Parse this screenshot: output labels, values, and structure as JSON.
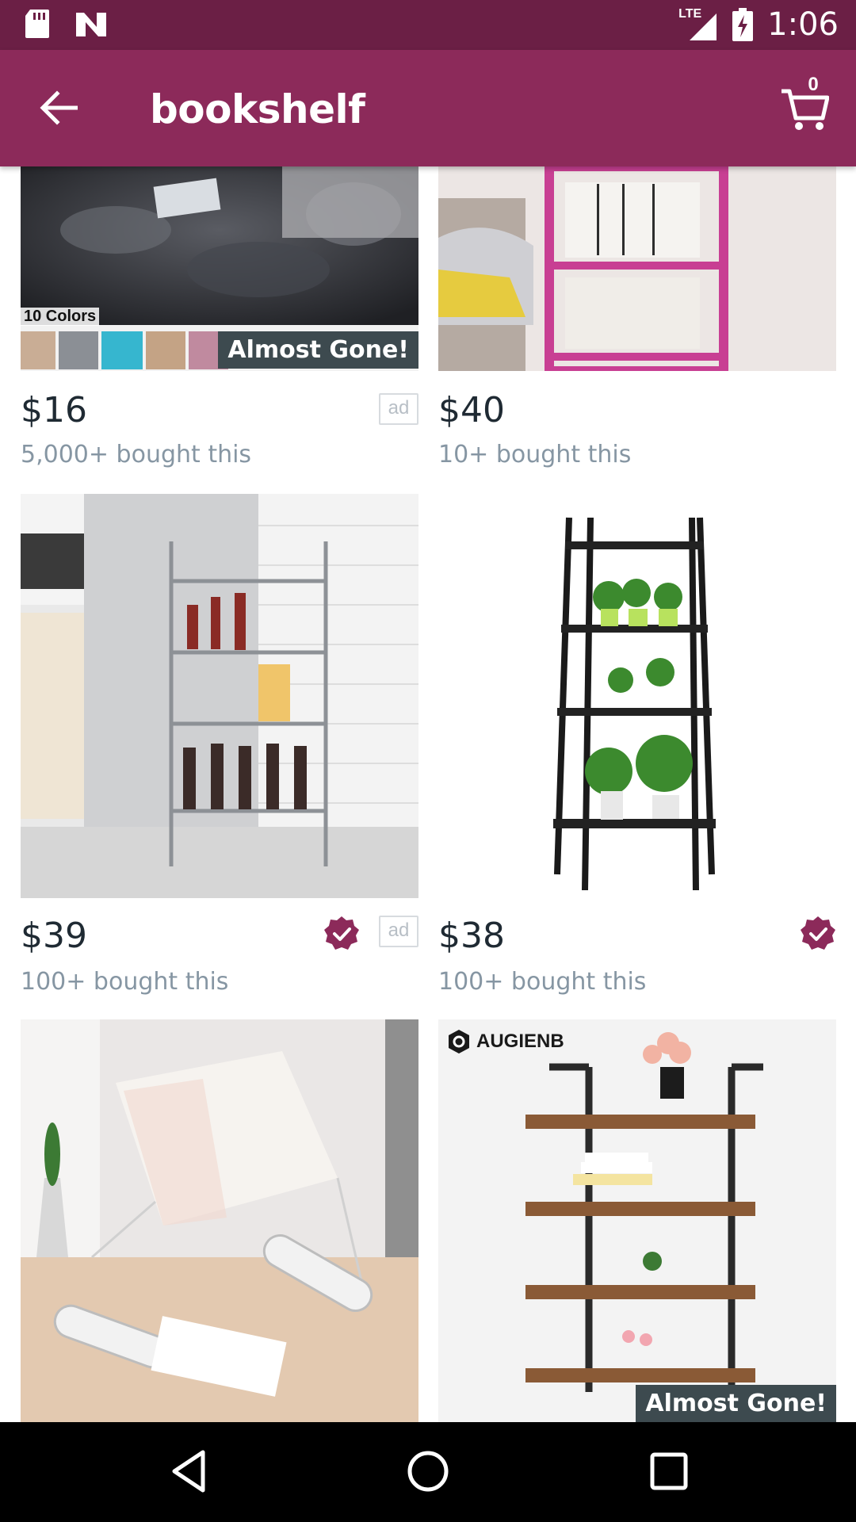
{
  "status_bar": {
    "time": "1:06",
    "network": "LTE",
    "icons": [
      "sd-card-icon",
      "n-notification-icon",
      "signal-icon",
      "battery-charging-icon"
    ]
  },
  "app_bar": {
    "title": "bookshelf",
    "cart_count": "0",
    "icons": [
      "back-arrow-icon",
      "cart-icon"
    ]
  },
  "colors": {
    "status_bar": "#6b1f45",
    "app_bar": "#8c2a5a",
    "price_text": "#1f2a33",
    "bought_text": "#8696a3",
    "badge_bg": "#3d4a4f",
    "verified": "#8c2a5a"
  },
  "products": [
    {
      "price": "$16",
      "bought": "5,000+ bought this",
      "ad": "ad",
      "badge": "Almost Gone!",
      "image_text": "10 Colors",
      "verified": false
    },
    {
      "price": "$40",
      "bought": "10+ bought this",
      "ad": "",
      "badge": "",
      "verified": false
    },
    {
      "price": "$39",
      "bought": "100+ bought this",
      "ad": "ad",
      "badge": "",
      "verified": true
    },
    {
      "price": "$38",
      "bought": "100+ bought this",
      "ad": "",
      "badge": "",
      "verified": true
    },
    {
      "price": "",
      "bought": "",
      "ad": "",
      "badge": "",
      "verified": false
    },
    {
      "price": "",
      "bought": "",
      "ad": "",
      "badge": "Almost Gone!",
      "brand": "AUGIENB",
      "verified": false
    }
  ],
  "nav_bar": {
    "icons": [
      "back-triangle-icon",
      "home-circle-icon",
      "recents-square-icon"
    ]
  }
}
